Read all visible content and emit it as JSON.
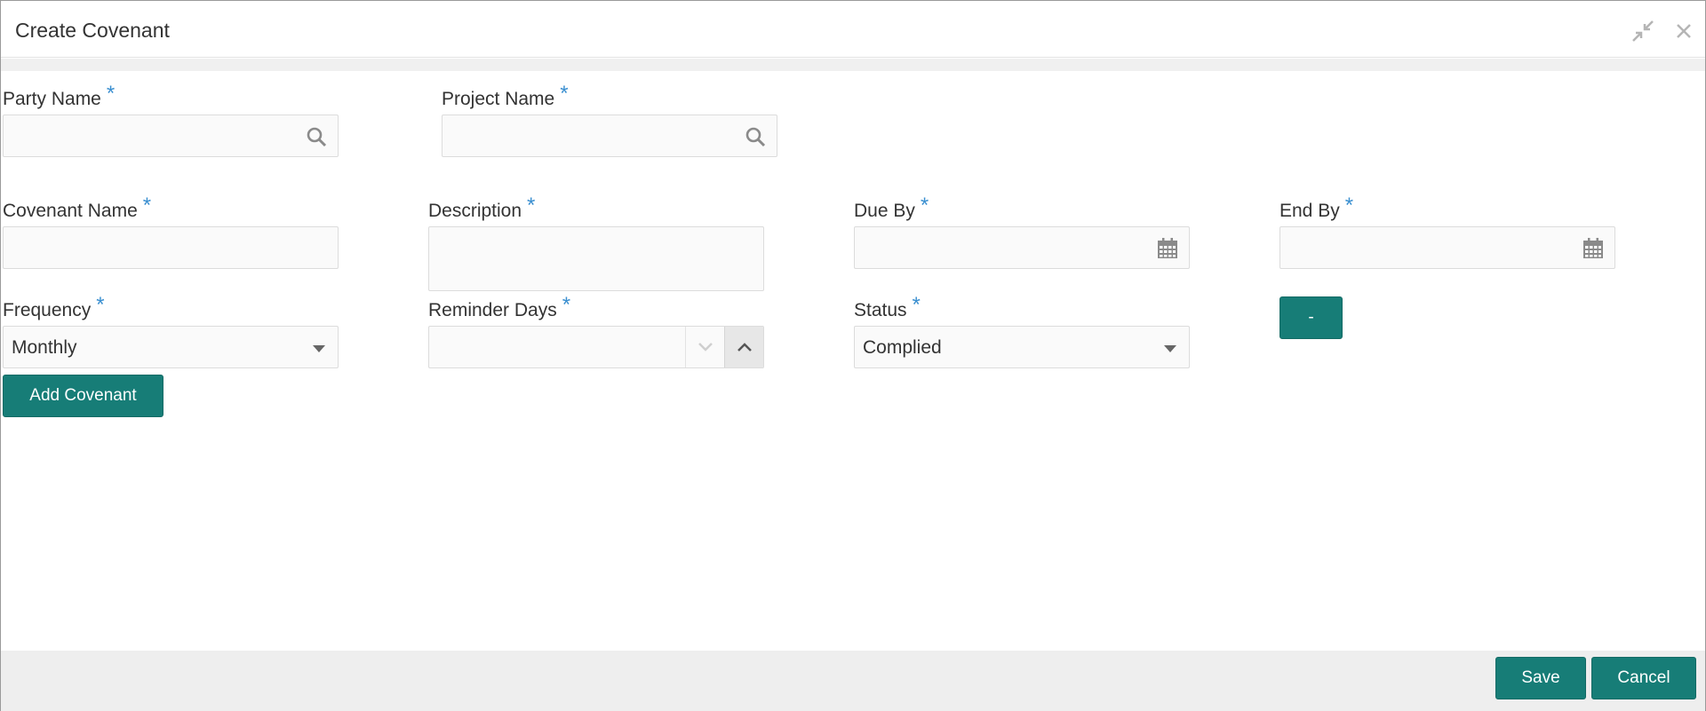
{
  "window": {
    "title": "Create Covenant",
    "minimize_icon": "compress-arrows-icon",
    "close_icon": "close-icon"
  },
  "form": {
    "party_name": {
      "label": "Party Name",
      "required": "*",
      "value": ""
    },
    "project_name": {
      "label": "Project Name",
      "required": "*",
      "value": ""
    },
    "covenant_name": {
      "label": "Covenant Name",
      "required": "*",
      "value": ""
    },
    "description": {
      "label": "Description",
      "required": "*",
      "value": ""
    },
    "due_by": {
      "label": "Due By",
      "required": "*",
      "value": ""
    },
    "end_by": {
      "label": "End By",
      "required": "*",
      "value": ""
    },
    "frequency": {
      "label": "Frequency",
      "required": "*",
      "value": "Monthly"
    },
    "reminder_days": {
      "label": "Reminder Days",
      "required": "*",
      "value": ""
    },
    "status": {
      "label": "Status",
      "required": "*",
      "value": "Complied"
    },
    "remove_label": "-",
    "add_covenant_label": "Add Covenant"
  },
  "footer": {
    "save_label": "Save",
    "cancel_label": "Cancel"
  },
  "colors": {
    "accent": "#177d77",
    "required": "#3a8fd0"
  }
}
